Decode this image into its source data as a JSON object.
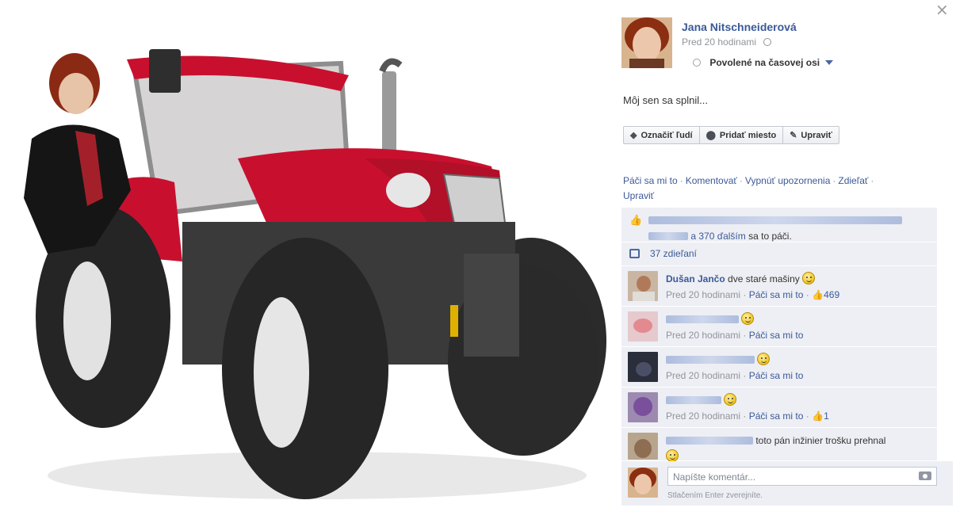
{
  "viewer": {
    "close_glyph": "×"
  },
  "post": {
    "author": "Jana Nitschneiderová",
    "time": "Pred 20 hodinami",
    "privacy_icon": "globe-icon",
    "timeline_status": "Povolené na časovej osi",
    "caption": "Môj sen sa splnil..."
  },
  "photo_buttons": [
    {
      "label": "Označiť ľudí",
      "icon": "tag-icon",
      "glyph": "◆"
    },
    {
      "label": "Pridať miesto",
      "icon": "pin-icon",
      "glyph": "⬤"
    },
    {
      "label": "Upraviť",
      "icon": "pencil-icon",
      "glyph": "✎"
    }
  ],
  "actions": {
    "like": "Páči sa mi to",
    "comment": "Komentovať",
    "notifications": "Vypnúť upozornenia",
    "share": "Zdieľať",
    "edit": "Upraviť",
    "separator": "·"
  },
  "likes": {
    "others": "a 370 ďalším",
    "suffix": "sa to páči."
  },
  "shares": "37 zdieľaní",
  "comments": [
    {
      "name": "Dušan Jančo",
      "text": "dve staré mašiny",
      "time": "Pred 20 hodinami",
      "like": "Páči sa mi to",
      "like_count": "469",
      "emoticon": true
    },
    {
      "name": "",
      "text": "",
      "time": "Pred 20 hodinami",
      "like": "Páči sa mi to",
      "like_count": "",
      "emoticon": true
    },
    {
      "name": "",
      "text": "",
      "time": "Pred 20 hodinami",
      "like": "Páči sa mi to",
      "like_count": "",
      "emoticon": true
    },
    {
      "name": "",
      "text": "",
      "time": "Pred 20 hodinami",
      "like": "Páči sa mi to",
      "like_count": "1",
      "emoticon": true
    },
    {
      "name": "",
      "text": "toto pán inžinier trošku prehnal",
      "time": "",
      "like": "",
      "like_count": "",
      "emoticon": true
    }
  ],
  "composer": {
    "placeholder": "Napíšte komentár...",
    "hint": "Stlačením Enter zverejníte."
  },
  "colors": {
    "link": "#3b5998",
    "panel": "#edeff4",
    "tractor_red": "#c8102e"
  }
}
